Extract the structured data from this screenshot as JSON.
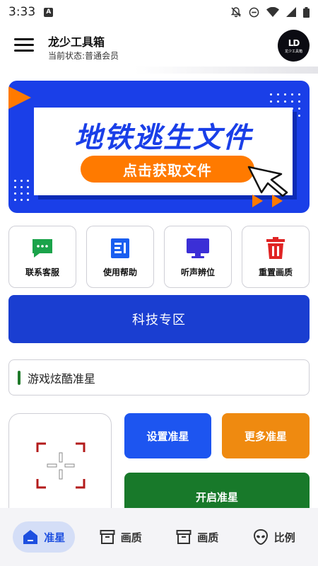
{
  "status_bar": {
    "time": "3:33",
    "notification_badge": "A",
    "icons": [
      "notifications-off-icon",
      "do-not-disturb-icon",
      "wifi-icon",
      "signal-icon",
      "battery-icon"
    ]
  },
  "header": {
    "title": "龙少工具箱",
    "status": "当前状态:普通会员",
    "avatar_logo": "LD",
    "avatar_caption": "龙少工具箱"
  },
  "banner": {
    "headline": "地铁逃生文件",
    "cta": "点击获取文件"
  },
  "tiles": [
    {
      "label": "联系客服",
      "icon": "chat-icon",
      "color": "#1aa34a"
    },
    {
      "label": "使用帮助",
      "icon": "document-icon",
      "color": "#1a5ef0"
    },
    {
      "label": "听声辨位",
      "icon": "monitor-icon",
      "color": "#3b2fd6"
    },
    {
      "label": "重置画质",
      "icon": "trash-icon",
      "color": "#e02424"
    }
  ],
  "tech_zone": "科技专区",
  "game_label": "游戏炫酷准星",
  "buttons": {
    "set_crosshair": "设置准星",
    "more_crosshair": "更多准星",
    "open_crosshair": "开启准星"
  },
  "bottom_nav": [
    {
      "label": "准星",
      "icon": "home-icon",
      "active": true
    },
    {
      "label": "画质",
      "icon": "archive-icon",
      "active": false
    },
    {
      "label": "画质",
      "icon": "archive-icon",
      "active": false
    },
    {
      "label": "比例",
      "icon": "alien-icon",
      "active": false
    }
  ],
  "colors": {
    "primary_blue": "#1a3ed1",
    "accent_orange": "#ef8a10",
    "accent_green": "#18792a",
    "crosshair_red": "#b31b1b"
  }
}
